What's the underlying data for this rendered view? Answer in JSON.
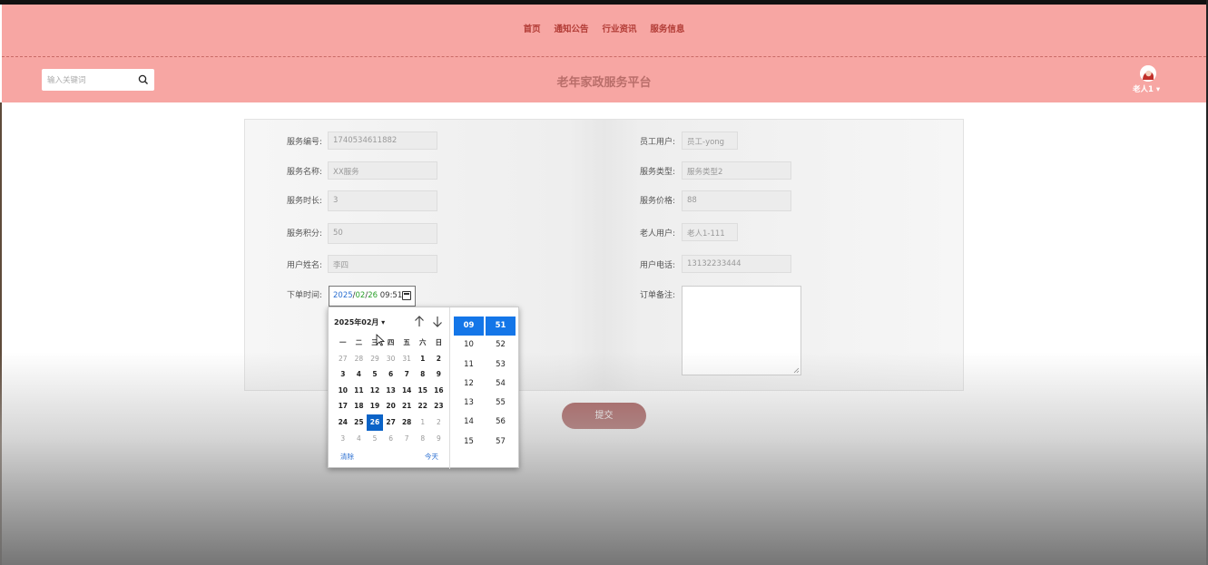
{
  "header": {
    "nav": [
      "首页",
      "通知公告",
      "行业资讯",
      "服务信息"
    ],
    "site_title": "老年家政服务平台",
    "search_placeholder": "输入关键词",
    "username": "老人1 ▾"
  },
  "form": {
    "left": [
      {
        "label": "服务编号:",
        "value": "1740534611882"
      },
      {
        "label": "服务名称:",
        "value": "XX服务"
      },
      {
        "label": "服务时长:",
        "value": "3"
      },
      {
        "label": "服务积分:",
        "value": "50"
      },
      {
        "label": "用户姓名:",
        "value": "李四"
      },
      {
        "label": "下单时间:"
      }
    ],
    "right": [
      {
        "label": "员工用户:",
        "value": "员工-yong"
      },
      {
        "label": "服务类型:",
        "value": "服务类型2"
      },
      {
        "label": "服务价格:",
        "value": "88"
      },
      {
        "label": "老人用户:",
        "value": "老人1-111"
      },
      {
        "label": "用户电话:",
        "value": "13132233444"
      },
      {
        "label": "订单备注:"
      }
    ],
    "datetime": {
      "year": "2025",
      "month": "02",
      "day": "26",
      "time": "09:51"
    },
    "submit_label": "提交"
  },
  "picker": {
    "month_label": "2025年02月 ▾",
    "weekdays": [
      "一",
      "二",
      "三",
      "四",
      "五",
      "六",
      "日"
    ],
    "weeks": [
      [
        "27",
        "28",
        "29",
        "30",
        "31",
        "1",
        "2"
      ],
      [
        "3",
        "4",
        "5",
        "6",
        "7",
        "8",
        "9"
      ],
      [
        "10",
        "11",
        "12",
        "13",
        "14",
        "15",
        "16"
      ],
      [
        "17",
        "18",
        "19",
        "20",
        "21",
        "22",
        "23"
      ],
      [
        "24",
        "25",
        "26",
        "27",
        "28",
        "1",
        "2"
      ],
      [
        "3",
        "4",
        "5",
        "6",
        "7",
        "8",
        "9"
      ]
    ],
    "selected_day": "26",
    "clear_label": "清除",
    "today_label": "今天",
    "hours": [
      "09",
      "10",
      "11",
      "12",
      "13",
      "14",
      "15"
    ],
    "minutes": [
      "51",
      "52",
      "53",
      "54",
      "55",
      "56",
      "57"
    ],
    "selected_hour": "09",
    "selected_minute": "51"
  }
}
